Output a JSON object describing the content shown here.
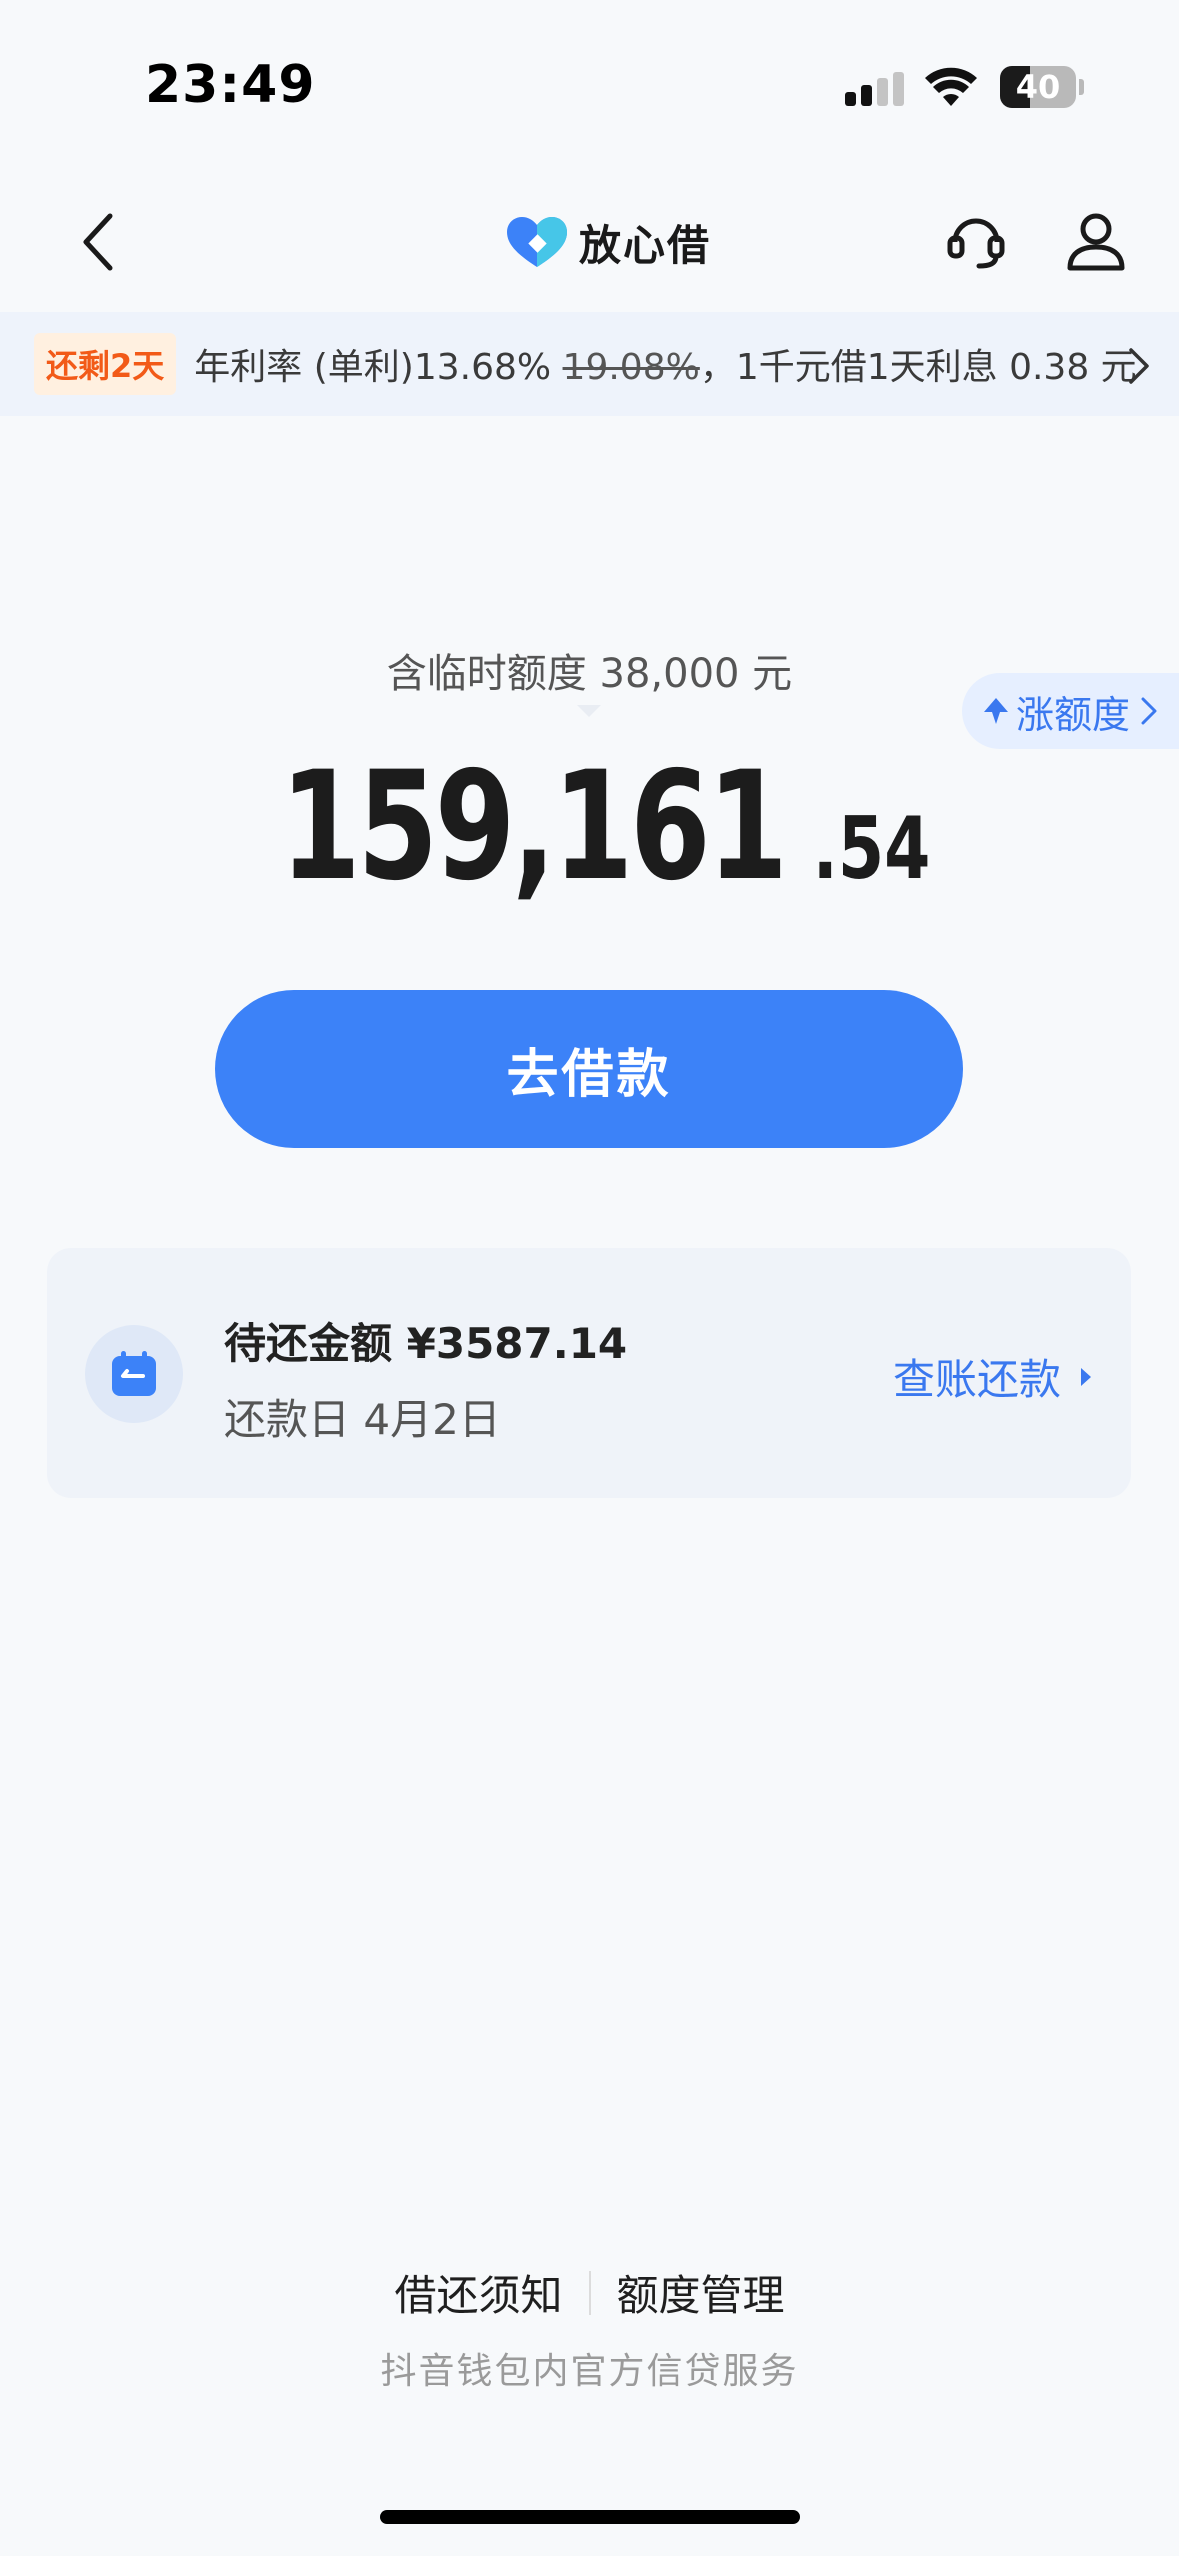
{
  "status_bar": {
    "time": "23:49",
    "battery_level": "40",
    "battery_fraction": 0.4
  },
  "nav": {
    "title": "放心借",
    "icons": [
      "back-icon",
      "headset-icon",
      "user-icon"
    ],
    "brand_colors": [
      "#3c82f8",
      "#46c6e8"
    ]
  },
  "promo": {
    "badge": "还剩2天",
    "text_prefix": "年利率 (单利)13.68%",
    "old_rate": "19.08%",
    "text_suffix": "，1千元借1天利息 0.38 元"
  },
  "limit": {
    "temp_limit_text": "含临时额度 38,000 元",
    "raise_label": "涨额度",
    "amount_integer": "159,161",
    "amount_decimal": ".54"
  },
  "borrow_button": {
    "label": "去借款"
  },
  "repayment": {
    "amount_label": "待还金额 ¥3587.14",
    "due_label": "还款日 4月2日",
    "link_label": "查账还款"
  },
  "footer": {
    "link_notice": "借还须知",
    "link_limit": "额度管理",
    "note": "抖音钱包内官方信贷服务"
  },
  "colors": {
    "accent": "#3c82f8",
    "badge_text": "#f25a18",
    "badge_bg": "#fff0e0",
    "link": "#3a78ef"
  }
}
